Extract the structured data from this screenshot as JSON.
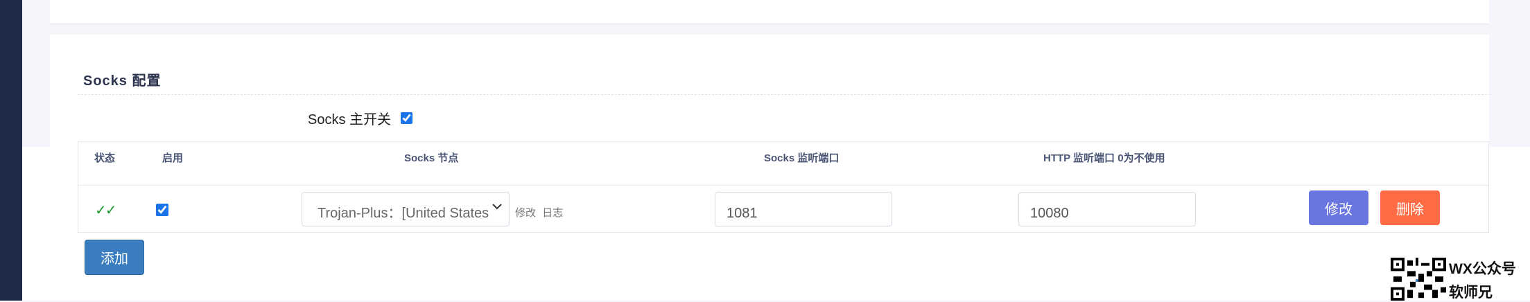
{
  "section": {
    "title": "Socks 配置"
  },
  "master_switch": {
    "label": "Socks 主开关",
    "checked": true
  },
  "table": {
    "headers": {
      "status": "状态",
      "enabled": "启用",
      "node": "Socks 节点",
      "socks_port": "Socks 监听端口",
      "http_port": "HTTP 监听端口 0为不使用"
    },
    "rows": [
      {
        "status": "✓✓",
        "enabled": true,
        "node": "Trojan-Plus：[United States",
        "edit_link": "修改",
        "log_link": "日志",
        "socks_port": "1081",
        "http_port": "10080",
        "edit_button": "修改",
        "delete_button": "删除"
      }
    ]
  },
  "add_button": "添加",
  "watermark": {
    "line1": "WX公众号",
    "line2": "软师兄"
  },
  "colors": {
    "sidebar": "#1e2a4a",
    "status_ok": "#1a9a2a",
    "edit_button": "#6a76e0",
    "delete_button": "#ff6b45",
    "add_button": "#3a7ebf"
  }
}
